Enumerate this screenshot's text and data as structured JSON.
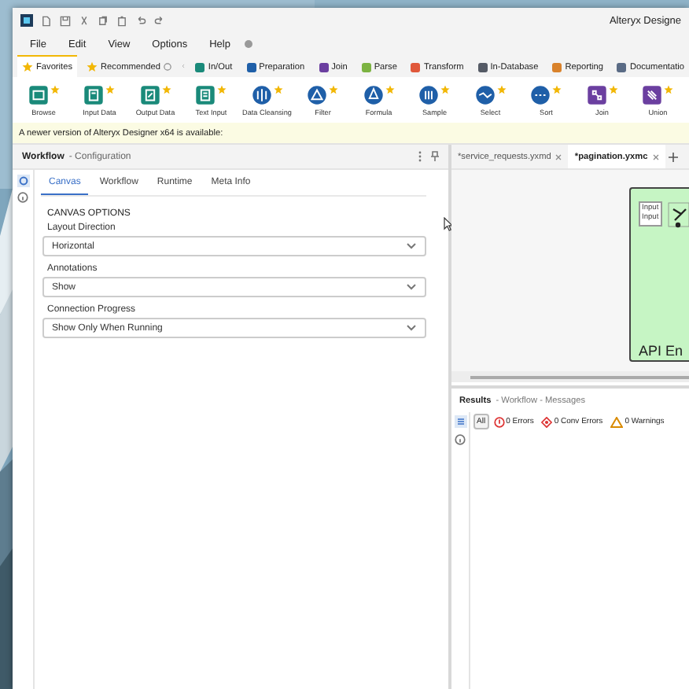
{
  "window": {
    "title": "Alteryx Designe"
  },
  "menu": [
    "File",
    "Edit",
    "View",
    "Options",
    "Help"
  ],
  "tool_tabs": [
    {
      "label": "Favorites",
      "kind": "star",
      "selected": true
    },
    {
      "label": "Recommended",
      "kind": "star",
      "selected": false
    },
    {
      "label": "In/Out",
      "kind": "category",
      "color": "#1a8a7a",
      "selected": false
    },
    {
      "label": "Preparation",
      "kind": "category",
      "color": "#1f5fa8",
      "selected": false
    },
    {
      "label": "Join",
      "kind": "category",
      "color": "#6b3fa0",
      "selected": false
    },
    {
      "label": "Parse",
      "kind": "category",
      "color": "#7cb342",
      "selected": false
    },
    {
      "label": "Transform",
      "kind": "category",
      "color": "#e0583a",
      "selected": false
    },
    {
      "label": "In-Database",
      "kind": "category",
      "color": "#555b66",
      "selected": false
    },
    {
      "label": "Reporting",
      "kind": "category",
      "color": "#d9822b",
      "selected": false
    },
    {
      "label": "Documentatio",
      "kind": "category",
      "color": "#5a6b85",
      "selected": false
    }
  ],
  "tools": [
    {
      "label": "Browse",
      "color": "#1a8a7a"
    },
    {
      "label": "Input Data",
      "color": "#1a8a7a"
    },
    {
      "label": "Output Data",
      "color": "#1a8a7a"
    },
    {
      "label": "Text Input",
      "color": "#1a8a7a"
    },
    {
      "label": "Data Cleansing",
      "color": "#1f5fa8"
    },
    {
      "label": "Filter",
      "color": "#1f5fa8"
    },
    {
      "label": "Formula",
      "color": "#1f5fa8"
    },
    {
      "label": "Sample",
      "color": "#1f5fa8"
    },
    {
      "label": "Select",
      "color": "#1f5fa8"
    },
    {
      "label": "Sort",
      "color": "#1f5fa8"
    },
    {
      "label": "Join",
      "color": "#6b3fa0"
    },
    {
      "label": "Union",
      "color": "#6b3fa0"
    }
  ],
  "banner": "A newer version of Alteryx Designer x64 is available:",
  "config_panel": {
    "title": "Workflow",
    "subtitle": "- Configuration",
    "tabs": [
      {
        "label": "Canvas",
        "selected": true
      },
      {
        "label": "Workflow",
        "selected": false
      },
      {
        "label": "Runtime",
        "selected": false
      },
      {
        "label": "Meta Info",
        "selected": false
      }
    ],
    "section": "CANVAS OPTIONS",
    "fields": [
      {
        "label": "Layout Direction",
        "value": "Horizontal"
      },
      {
        "label": "Annotations",
        "value": "Show"
      },
      {
        "label": "Connection Progress",
        "value": "Show Only When Running"
      }
    ]
  },
  "documents": {
    "tabs": [
      {
        "label": "*service_requests.yxmd",
        "selected": false
      },
      {
        "label": "*pagination.yxmc",
        "selected": true
      }
    ],
    "canvas": {
      "container_label": "API En",
      "node_labels": [
        "Input",
        "Input"
      ]
    }
  },
  "results": {
    "title": "Results",
    "subtitle": "- Workflow - Messages",
    "filters": [
      {
        "label": "All",
        "kind": "all",
        "selected": true
      },
      {
        "label": "0 Errors",
        "kind": "error",
        "selected": false
      },
      {
        "label": "0 Conv Errors",
        "kind": "conv",
        "selected": false
      },
      {
        "label": "0 Warnings",
        "kind": "warning",
        "selected": false
      }
    ]
  }
}
